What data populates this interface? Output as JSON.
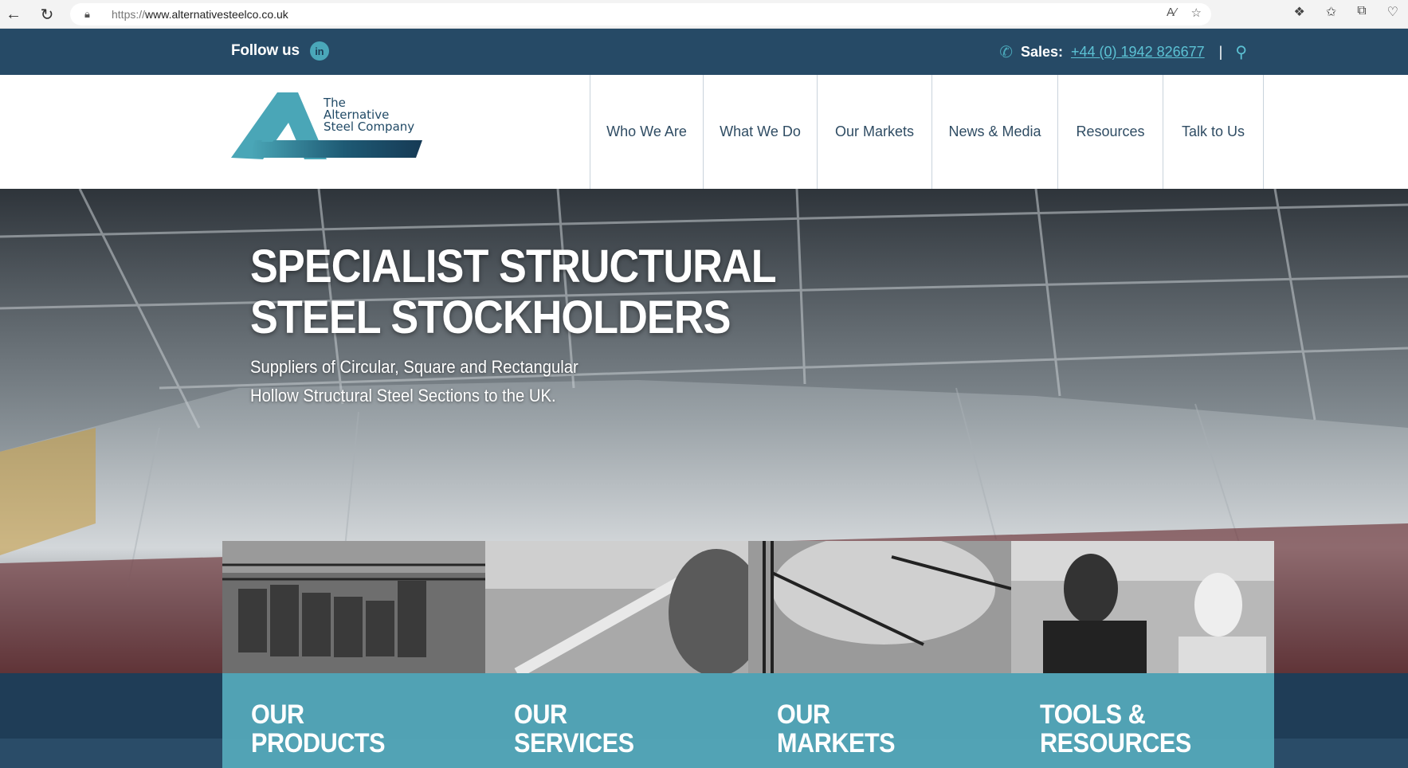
{
  "browser": {
    "url_prefix": "https://",
    "url_host": "www.alternativesteelco.co.uk"
  },
  "topbar": {
    "follow_label": "Follow us",
    "linkedin_text": "in",
    "sales_label": "Sales:",
    "sales_number": "+44 (0) 1942 826677",
    "divider": "|"
  },
  "logo": {
    "line1": "The",
    "line2": "Alternative",
    "line3": "Steel Company"
  },
  "nav": {
    "items": [
      {
        "label": "Who We Are"
      },
      {
        "label": "What We Do"
      },
      {
        "label": "Our Markets"
      },
      {
        "label": "News & Media"
      },
      {
        "label": "Resources"
      },
      {
        "label": "Talk to Us"
      }
    ]
  },
  "hero": {
    "title_line1": "SPECIALIST STRUCTURAL",
    "title_line2": "STEEL STOCKHOLDERS",
    "subtitle_line1": "Suppliers of Circular, Square and Rectangular",
    "subtitle_line2": "Hollow Structural Steel Sections to the UK."
  },
  "tiles": [
    {
      "line1": "OUR",
      "line2": "PRODUCTS"
    },
    {
      "line1": "OUR",
      "line2": "SERVICES"
    },
    {
      "line1": "OUR",
      "line2": "MARKETS"
    },
    {
      "line1": "TOOLS &",
      "line2": "RESOURCES"
    }
  ],
  "colors": {
    "topbar_bg": "#264a66",
    "accent_teal": "#4aa7b9",
    "link_teal": "#5cc2d4",
    "nav_text": "#2f4c63"
  },
  "icons": {
    "back": "back-arrow-icon",
    "refresh": "refresh-icon",
    "lock": "lock-icon",
    "read_aloud": "read-aloud-icon",
    "favorite": "star-icon",
    "extensions": "puzzle-icon",
    "favorites": "favorites-icon",
    "collections": "collections-icon",
    "performance": "heart-pulse-icon",
    "linkedin": "linkedin-icon",
    "phone": "phone-icon",
    "search": "search-icon"
  }
}
